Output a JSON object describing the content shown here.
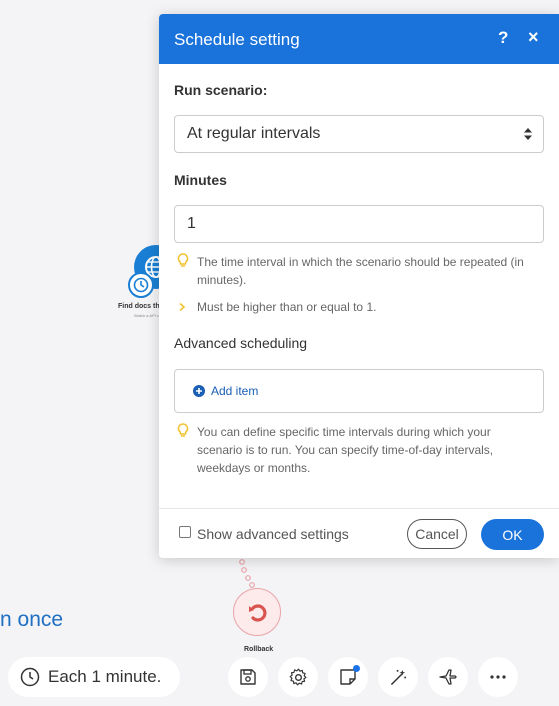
{
  "canvas": {
    "module_label": "Find docs tha...",
    "module_sublabel": "Watch a API ch...",
    "rollback_label": "Rollback",
    "run_once_text": "n once"
  },
  "toolbar": {
    "schedule_text": "Each 1 minute.",
    "icons": [
      "clock-icon",
      "save-icon",
      "gear-icon",
      "notes-icon",
      "magic-wand-icon",
      "airplane-icon",
      "more-icon"
    ]
  },
  "modal": {
    "title": "Schedule setting",
    "help": "?",
    "close": "×",
    "run_scenario_label": "Run scenario:",
    "run_scenario_value": "At regular intervals",
    "minutes_label": "Minutes",
    "minutes_value": "1",
    "minutes_hint": "The time interval in which the scenario should be repeated (in minutes).",
    "minutes_rule": "Must be higher than or equal to 1.",
    "advanced_label": "Advanced scheduling",
    "add_item": "Add item",
    "advanced_hint": "You can define specific time intervals during which your scenario is to run. You can specify time-of-day intervals, weekdays or months.",
    "show_advanced": "Show advanced settings",
    "cancel": "Cancel",
    "ok": "OK"
  },
  "colors": {
    "accent": "#1a73db",
    "hint_bulb": "#f2c230",
    "rollback": "#d9534f"
  }
}
